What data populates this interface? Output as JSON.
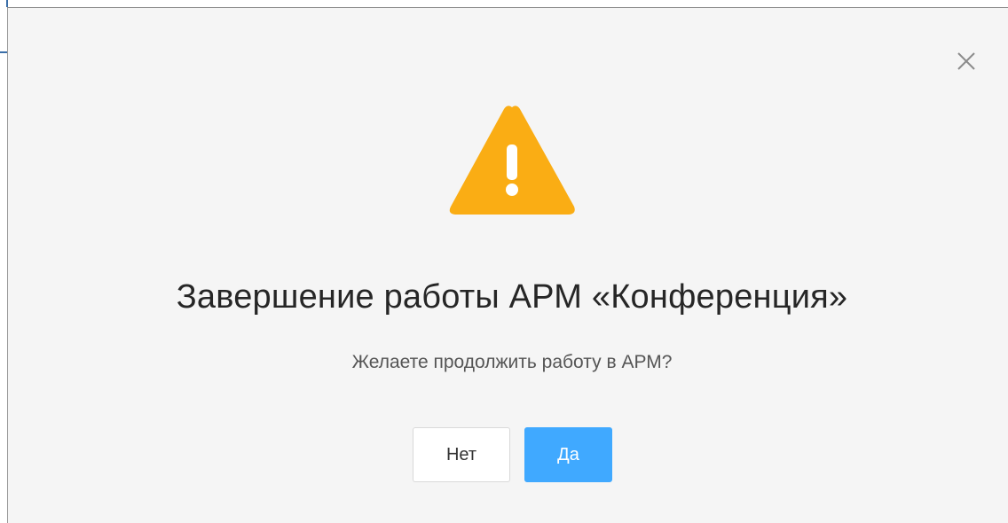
{
  "dialog": {
    "title": "Завершение работы АРМ «Конференция»",
    "message": "Желаете продолжить работу в АРМ?",
    "buttons": {
      "no_label": "Нет",
      "yes_label": "Да"
    },
    "close_icon": "close-icon",
    "warning_icon": "warning-triangle-icon"
  },
  "colors": {
    "warning": "#faad14",
    "primary": "#40a9ff",
    "dialog_bg": "#f5f5f5",
    "title_text": "#262626",
    "message_text": "#555555"
  }
}
